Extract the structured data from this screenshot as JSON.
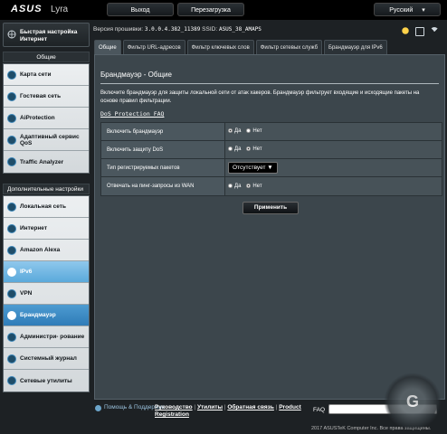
{
  "header": {
    "logo": "ASUS",
    "product": "Lyra",
    "logout_label": "Выход",
    "reboot_label": "Перезагрузка",
    "language_label": "Русский"
  },
  "info": {
    "firmware_label": "Версия прошивки:",
    "firmware_value": "3.0.0.4.382_11389",
    "ssid_label": "SSID:",
    "ssid_value": "ASUS_38_AMAPS"
  },
  "sidebar": {
    "quick_setup": "Быстрая настройка Интернет",
    "general_header": "Общие",
    "general_items": [
      {
        "label": "Карта сети"
      },
      {
        "label": "Гостевая сеть"
      },
      {
        "label": "AiProtection"
      },
      {
        "label": "Адаптивный сервис QoS"
      },
      {
        "label": "Traffic Analyzer"
      }
    ],
    "advanced_header": "Дополнительные настройки",
    "advanced_items": [
      {
        "label": "Локальная сеть"
      },
      {
        "label": "Интернет"
      },
      {
        "label": "Amazon Alexa"
      },
      {
        "label": "IPv6"
      },
      {
        "label": "VPN"
      },
      {
        "label": "Брандмауэр"
      },
      {
        "label": "Администри- рование"
      },
      {
        "label": "Системный журнал"
      },
      {
        "label": "Сетевые утилиты"
      }
    ]
  },
  "tabs": [
    {
      "label": "Общие"
    },
    {
      "label": "Фильтр URL-адресов"
    },
    {
      "label": "Фильтр ключевых слов"
    },
    {
      "label": "Фильтр сетевых служб"
    },
    {
      "label": "Брандмауэр для IPv6"
    }
  ],
  "main": {
    "title": "Брандмауэр - Общие",
    "description": "Включите брандмауэр для защиты локальной сети от атак хакеров. Брандмауэр фильтрует входящие и исходящие пакеты на основе правил фильтрации.",
    "faq_link": "DoS Protection FAQ",
    "rows": [
      {
        "label": "Включить брандмауэр",
        "type": "radio",
        "yes": "Да",
        "no": "Нет",
        "selected": "yes"
      },
      {
        "label": "Включить защиту DoS",
        "type": "radio",
        "yes": "Да",
        "no": "Нет",
        "selected": "no"
      },
      {
        "label": "Тип регистрируемых пакетов",
        "type": "select",
        "value": "Отсутствует"
      },
      {
        "label": "Отвечать на пинг-запросы из WAN",
        "type": "radio",
        "yes": "Да",
        "no": "Нет",
        "selected": "no"
      }
    ],
    "apply_label": "Применить"
  },
  "footer": {
    "help_label": "Помощь & Поддержка",
    "links": [
      "Руководство",
      "Утилиты",
      "Обратная связь",
      "Product Registration"
    ],
    "faq_label": "FAQ",
    "copyright": "2017 ASUSTeK Computer Inc. Все права защищены."
  },
  "watermark": "G"
}
